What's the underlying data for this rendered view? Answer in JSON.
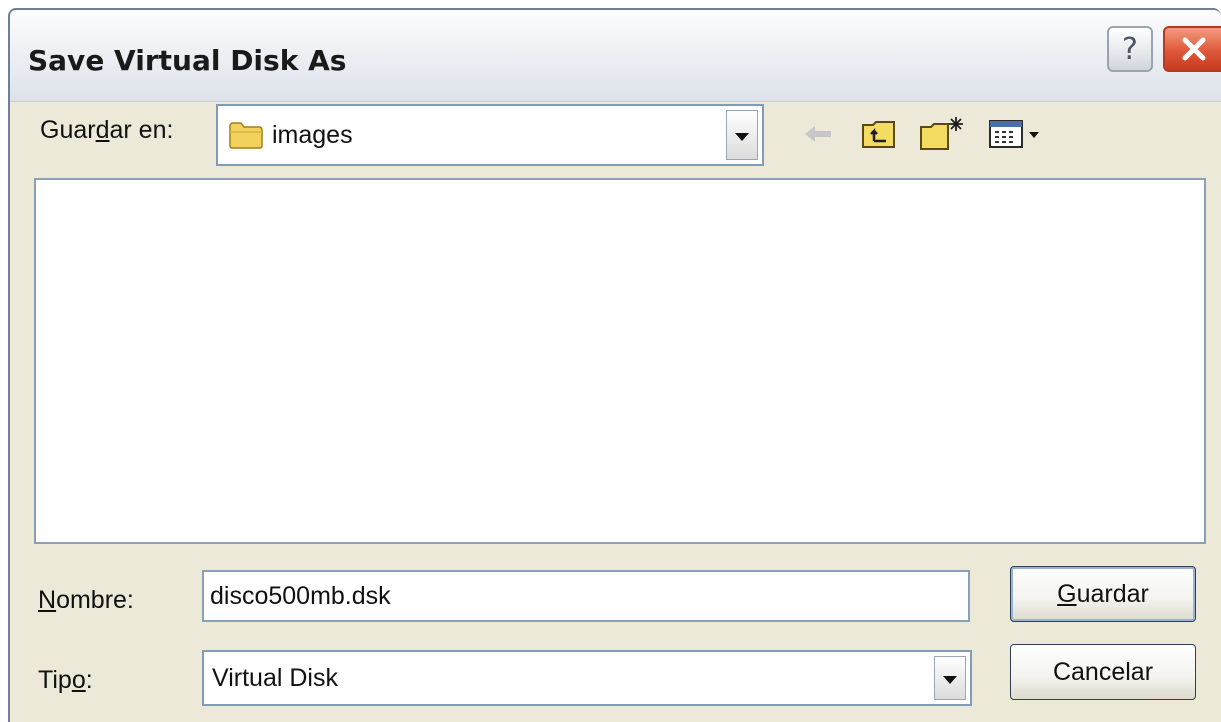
{
  "window": {
    "title": "Save Virtual Disk As",
    "help_label": "?"
  },
  "location": {
    "label_pre": "Guar",
    "label_key": "d",
    "label_post": "ar en:",
    "folder": "images"
  },
  "toolbar": {
    "icons": [
      "back-arrow-icon",
      "up-folder-icon",
      "new-folder-icon",
      "view-menu-icon"
    ]
  },
  "filename": {
    "label_key": "N",
    "label_post": "ombre:",
    "value": "disco500mb.dsk"
  },
  "filetype": {
    "label_pre": "Tip",
    "label_key": "o",
    "label_post": ":",
    "value": "Virtual Disk"
  },
  "buttons": {
    "save_key": "G",
    "save_post": "uardar",
    "cancel": "Cancelar"
  },
  "colors": {
    "dialog_bg": "#ece9d8",
    "close_red": "#e0583a",
    "folder_yellow": "#f2d25c"
  }
}
